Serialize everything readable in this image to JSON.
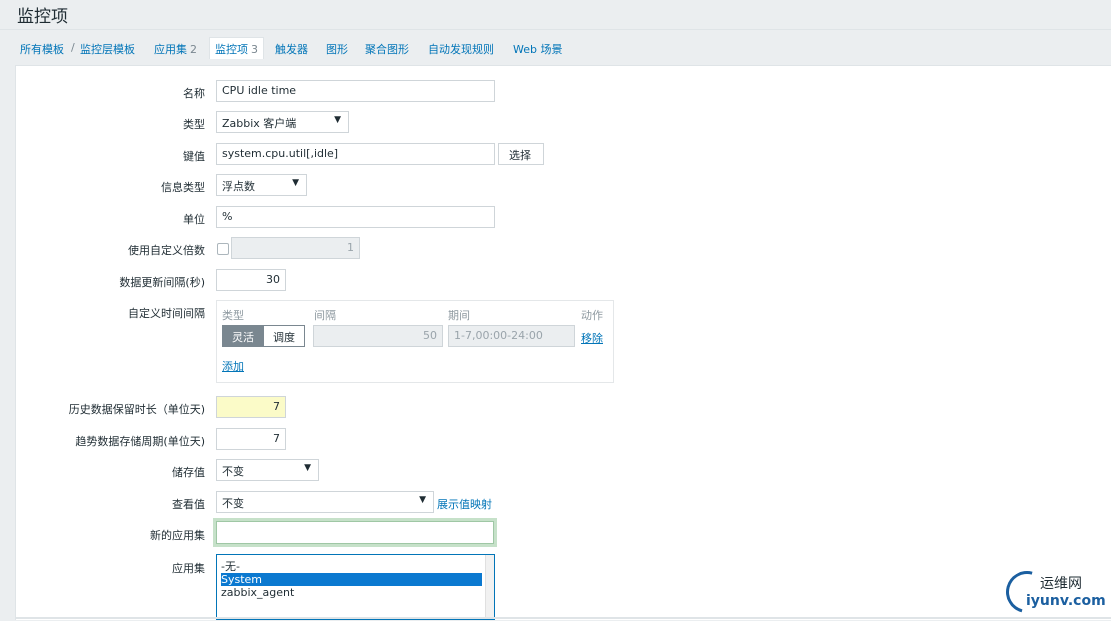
{
  "page": {
    "title": "监控项"
  },
  "tabs": [
    {
      "label": "所有模板"
    },
    {
      "label": "/"
    },
    {
      "label": "监控层模板"
    },
    {
      "label": "应用集",
      "count": "2"
    },
    {
      "label": "监控项",
      "count": "3"
    },
    {
      "label": "触发器"
    },
    {
      "label": "图形"
    },
    {
      "label": "聚合图形"
    },
    {
      "label": "自动发现规则"
    },
    {
      "label": "Web 场景"
    }
  ],
  "form": {
    "name": {
      "label": "名称",
      "value": "CPU idle time"
    },
    "type": {
      "label": "类型",
      "value": "Zabbix 客户端"
    },
    "key": {
      "label": "键值",
      "value": "system.cpu.util[,idle]",
      "button": "选择"
    },
    "info_type": {
      "label": "信息类型",
      "value": "浮点数"
    },
    "units": {
      "label": "单位",
      "value": "%"
    },
    "multiplier": {
      "label": "使用自定义倍数",
      "value": "1",
      "checked": false
    },
    "interval": {
      "label": "数据更新间隔(秒)",
      "value": "30"
    },
    "custom_intervals": {
      "label": "自定义时间间隔",
      "headers": {
        "type": "类型",
        "interval": "间隔",
        "period": "期间",
        "action": "动作"
      },
      "flexible": "灵活",
      "scheduling": "调度",
      "row_interval": "50",
      "row_period": "1-7,00:00-24:00",
      "remove": "移除",
      "add": "添加"
    },
    "history": {
      "label": "历史数据保留时长（单位天)",
      "value": "7"
    },
    "trends": {
      "label": "趋势数据存储周期(单位天)",
      "value": "7"
    },
    "store_value": {
      "label": "储存值",
      "value": "不变"
    },
    "show_value": {
      "label": "查看值",
      "value": "不变",
      "link": "展示值映射"
    },
    "new_application": {
      "label": "新的应用集",
      "value": ""
    },
    "applications": {
      "label": "应用集",
      "options": [
        "-无-",
        "System",
        "zabbix_agent"
      ],
      "selected": "System"
    }
  },
  "watermark": {
    "cn": "运维网",
    "en": "iyunv.com"
  }
}
